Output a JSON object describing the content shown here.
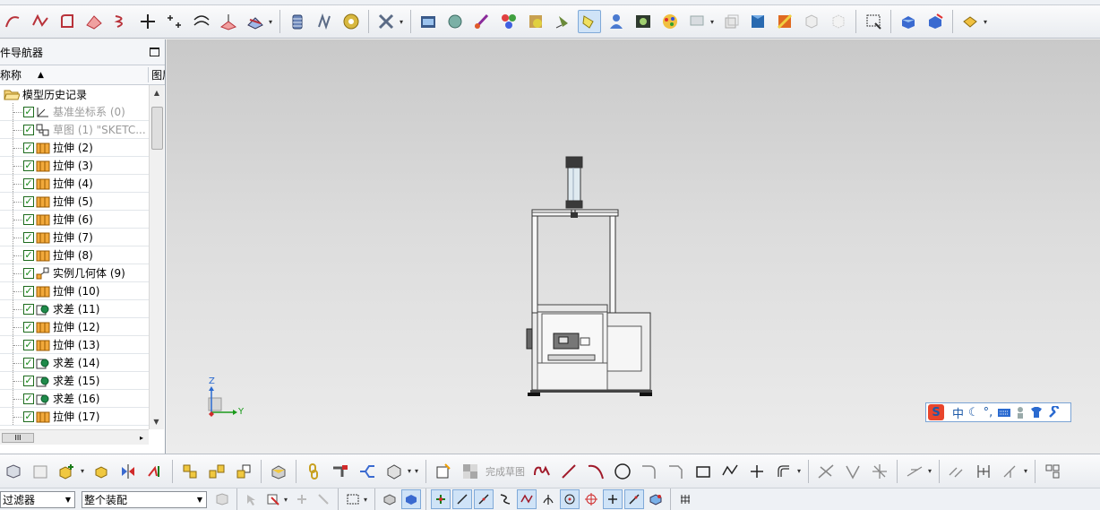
{
  "navigator": {
    "title": "件导航器",
    "col_name": "称称",
    "col_second": "图层",
    "root_label": "模型历史记录",
    "features": [
      {
        "label": "基准坐标系 (0)",
        "icon": "datum-csys-icon",
        "dim": true
      },
      {
        "label": "草图 (1) \"SKETC...",
        "icon": "sketch-icon",
        "dim": true
      },
      {
        "label": "拉伸 (2)",
        "icon": "extrude-icon",
        "dim": false
      },
      {
        "label": "拉伸 (3)",
        "icon": "extrude-icon",
        "dim": false
      },
      {
        "label": "拉伸 (4)",
        "icon": "extrude-icon",
        "dim": false
      },
      {
        "label": "拉伸 (5)",
        "icon": "extrude-icon",
        "dim": false
      },
      {
        "label": "拉伸 (6)",
        "icon": "extrude-icon",
        "dim": false
      },
      {
        "label": "拉伸 (7)",
        "icon": "extrude-icon",
        "dim": false
      },
      {
        "label": "拉伸 (8)",
        "icon": "extrude-icon",
        "dim": false
      },
      {
        "label": "实例几何体 (9)",
        "icon": "instance-geometry-icon",
        "dim": false
      },
      {
        "label": "拉伸 (10)",
        "icon": "extrude-icon",
        "dim": false
      },
      {
        "label": "求差 (11)",
        "icon": "subtract-icon",
        "dim": false
      },
      {
        "label": "拉伸 (12)",
        "icon": "extrude-icon",
        "dim": false
      },
      {
        "label": "拉伸 (13)",
        "icon": "extrude-icon",
        "dim": false
      },
      {
        "label": "求差 (14)",
        "icon": "subtract-icon",
        "dim": false
      },
      {
        "label": "求差 (15)",
        "icon": "subtract-icon",
        "dim": false
      },
      {
        "label": "求差 (16)",
        "icon": "subtract-icon",
        "dim": false
      },
      {
        "label": "拉伸 (17)",
        "icon": "extrude-icon",
        "dim": false
      }
    ],
    "hscroll_thumb": "III"
  },
  "viewport": {
    "triad": {
      "z": "Z",
      "y": "Y"
    }
  },
  "ime": {
    "logo": "S",
    "mode": "中"
  },
  "sketch_toolbar": {
    "finish_sketch": "完成草图"
  },
  "selection_bar": {
    "filter_value": "过滤器",
    "scope_value": "整个装配"
  },
  "colors": {
    "viewport_top": "#c9c9c9",
    "viewport_bottom": "#ececec",
    "selection_blue": "#cfe3f7"
  }
}
